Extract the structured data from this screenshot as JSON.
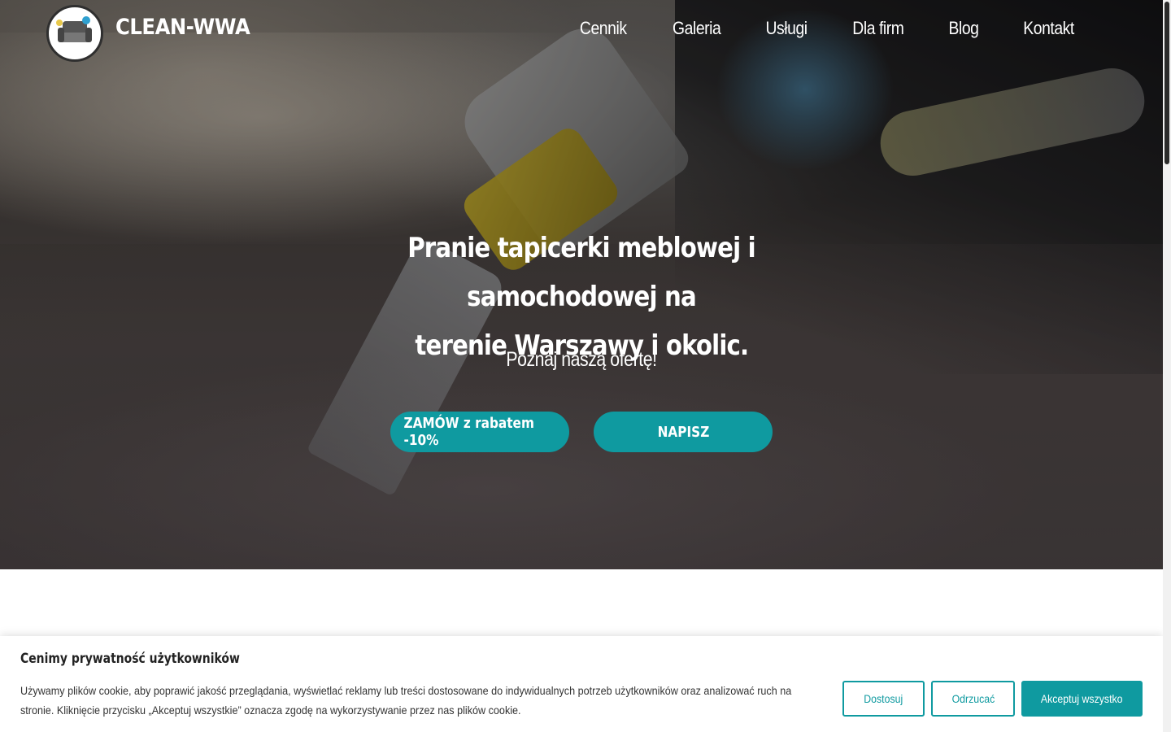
{
  "header": {
    "brand": "CLEAN-WWA",
    "nav": [
      "Cennik",
      "Galeria",
      "Usługi",
      "Dla firm",
      "Blog",
      "Kontakt"
    ]
  },
  "hero": {
    "title_line1": "Pranie tapicerki meblowej i samochodowej na",
    "title_line2": "terenie Warszawy i okolic.",
    "subtitle": "Poznaj naszą ofertę!",
    "order_button": "ZAMÓW z rabatem -10%",
    "write_button": "NAPISZ"
  },
  "cookie": {
    "title": "Cenimy prywatność użytkowników",
    "text": "Używamy plików cookie, aby poprawić jakość przeglądania, wyświetlać reklamy lub treści dostosowane do indywidualnych potrzeb użytkowników oraz analizować ruch na stronie. Kliknięcie przycisku „Akceptuj wszystkie” oznacza zgodę na wykorzystywanie przez nas plików cookie.",
    "customize": "Dostosuj",
    "reject": "Odrzucać",
    "accept": "Akceptuj wszystko"
  },
  "colors": {
    "accent": "#0f9aa0",
    "hero_text": "#ffffff"
  }
}
